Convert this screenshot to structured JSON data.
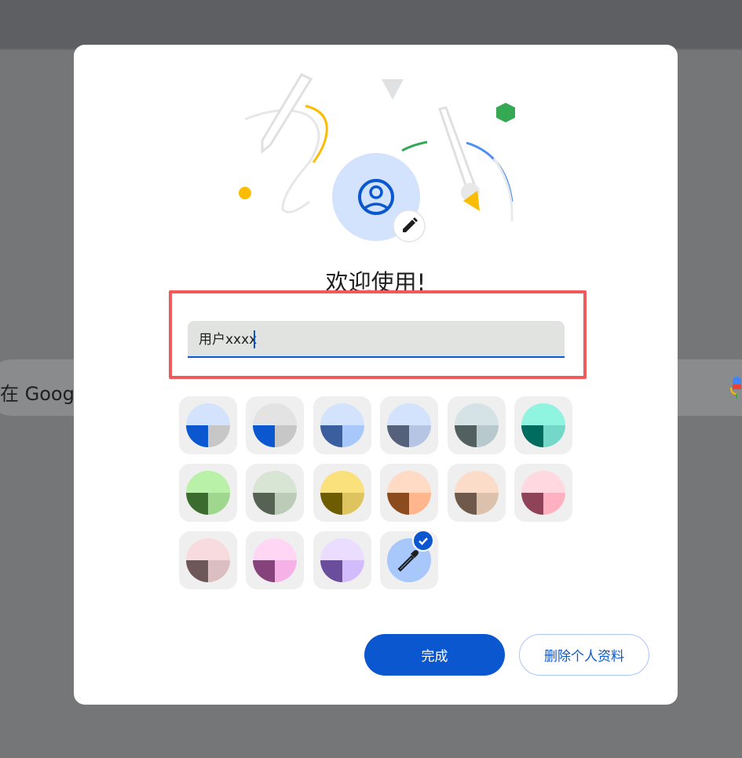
{
  "background": {
    "search_text": "在 Googl"
  },
  "dialog": {
    "welcome_title": "欢迎使用!",
    "name_field": {
      "value": "用户xxxx"
    },
    "color_options": [
      {
        "name": "default-blue-grey",
        "top": "#d3e3fd",
        "left": "#0b57d0",
        "right": "#c7c7c7"
      },
      {
        "name": "grey",
        "top": "#e3e3e3",
        "left": "#0b57d0",
        "right": "#c7c7c7"
      },
      {
        "name": "blue",
        "top": "#d3e3fd",
        "left": "#3b5f9e",
        "right": "#a8c7fa"
      },
      {
        "name": "slate",
        "top": "#d3e3fd",
        "left": "#55607a",
        "right": "#b6c5e3"
      },
      {
        "name": "blue-grey",
        "top": "#d5e3e7",
        "left": "#52605f",
        "right": "#b8c9cd"
      },
      {
        "name": "teal",
        "top": "#8ff4e0",
        "left": "#006b5f",
        "right": "#73d8c8"
      },
      {
        "name": "green",
        "top": "#b9f1a8",
        "left": "#3c6b2f",
        "right": "#9ed78d"
      },
      {
        "name": "sage",
        "top": "#d8e5d4",
        "left": "#566354",
        "right": "#bccbb8"
      },
      {
        "name": "yellow",
        "top": "#fbe17b",
        "left": "#6e5d00",
        "right": "#dec45f"
      },
      {
        "name": "orange",
        "top": "#ffdbc6",
        "left": "#8b4b1d",
        "right": "#ffb68c"
      },
      {
        "name": "peach",
        "top": "#fadcc9",
        "left": "#6e594a",
        "right": "#dcc1ad"
      },
      {
        "name": "rose",
        "top": "#ffd9df",
        "left": "#8e4359",
        "right": "#ffb0c1"
      },
      {
        "name": "mauve",
        "top": "#f7dbde",
        "left": "#6e5759",
        "right": "#dbbec1"
      },
      {
        "name": "magenta",
        "top": "#ffd7f4",
        "left": "#86427a",
        "right": "#f6b2e7"
      },
      {
        "name": "lavender",
        "top": "#ebddff",
        "left": "#6a4e9c",
        "right": "#d3bcfd"
      }
    ],
    "custom_color": {
      "fill": "#a8c7fa",
      "selected": true,
      "icon": "eyedropper-icon"
    },
    "buttons": {
      "done": "完成",
      "delete_profile": "删除个人资料"
    },
    "accent": "#0b57d0"
  }
}
